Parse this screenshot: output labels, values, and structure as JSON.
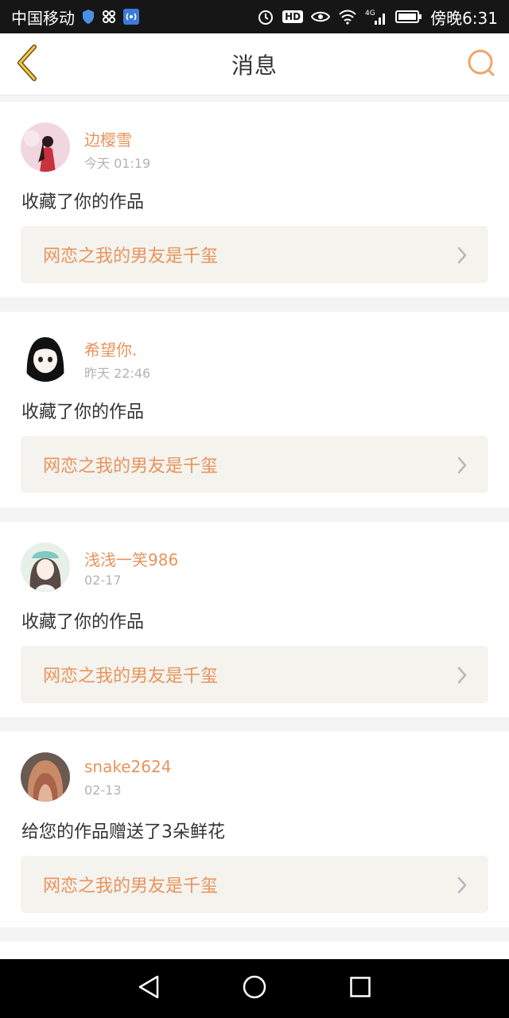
{
  "status_bar": {
    "carrier": "中国移动",
    "time": "傍晚6:31",
    "network": "4G",
    "icons": [
      "shield-icon",
      "app-icon",
      "hotspot-icon",
      "alarm-icon",
      "hd-icon",
      "eye-icon",
      "wifi-icon",
      "signal-icon",
      "battery-icon"
    ]
  },
  "header": {
    "title": "消息",
    "back_icon": "back-chevron-icon",
    "search_icon": "search-icon",
    "accent_color": "#e8935c"
  },
  "messages": [
    {
      "username": "边樱雪",
      "time": "今天 01:19",
      "action": "收藏了你的作品",
      "work_title": "网恋之我的男友是千玺"
    },
    {
      "username": "希望你.",
      "time": "昨天 22:46",
      "action": "收藏了你的作品",
      "work_title": "网恋之我的男友是千玺"
    },
    {
      "username": "浅浅一笑986",
      "time": "02-17",
      "action": "收藏了你的作品",
      "work_title": "网恋之我的男友是千玺"
    },
    {
      "username": "snake2624",
      "time": "02-13",
      "action": "给您的作品赠送了3朵鲜花",
      "work_title": "网恋之我的男友是千玺"
    }
  ],
  "system_nav": {
    "icons": [
      "back-triangle-icon",
      "home-circle-icon",
      "recents-square-icon"
    ]
  }
}
